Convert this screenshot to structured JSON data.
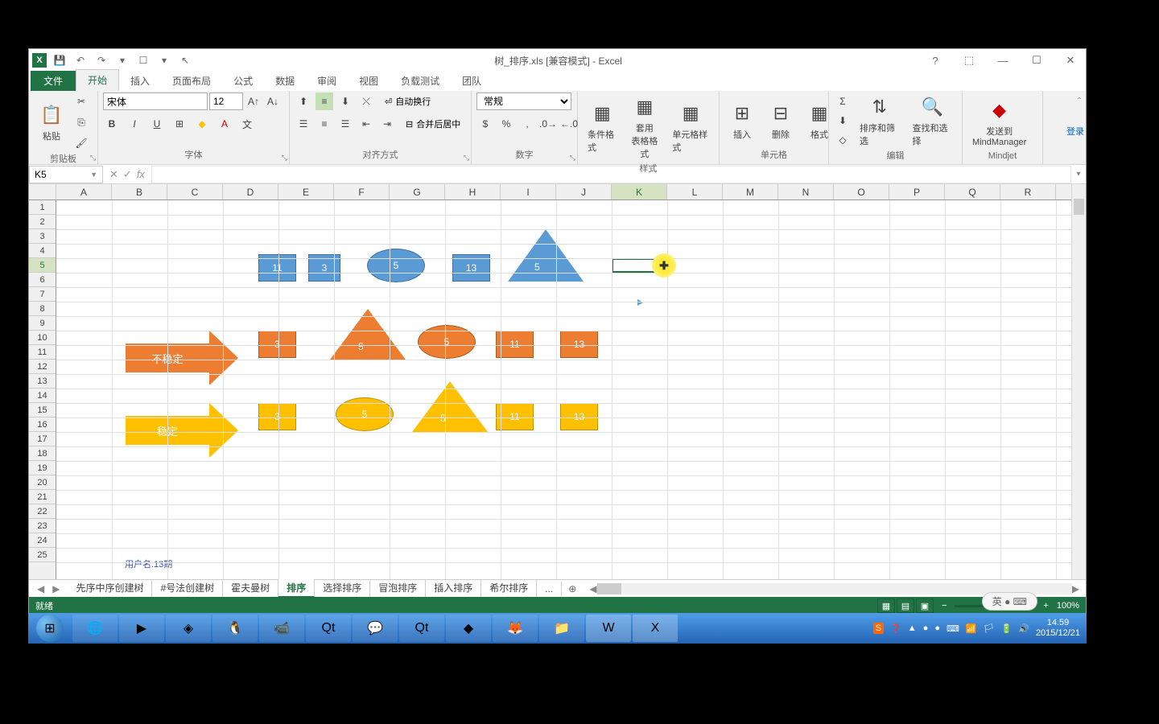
{
  "title": "树_排序.xls [兼容模式] - Excel",
  "login": "登录",
  "tabs": {
    "file": "文件",
    "items": [
      "开始",
      "插入",
      "页面布局",
      "公式",
      "数据",
      "审阅",
      "视图",
      "负载测试",
      "团队"
    ],
    "active": 0
  },
  "ribbon": {
    "clipboard": {
      "label": "剪贴板",
      "paste": "粘贴"
    },
    "font": {
      "label": "字体",
      "name": "宋体",
      "size": "12"
    },
    "alignment": {
      "label": "对齐方式",
      "wrap": "自动换行",
      "merge": "合并后居中"
    },
    "number": {
      "label": "数字",
      "format": "常规"
    },
    "styles": {
      "label": "样式",
      "cond": "条件格式",
      "table": "套用\n表格格式",
      "cell": "单元格样式"
    },
    "cells": {
      "label": "单元格",
      "insert": "插入",
      "delete": "删除",
      "format": "格式"
    },
    "editing": {
      "label": "编辑",
      "sort": "排序和筛选",
      "find": "查找和选择"
    },
    "mindjet": {
      "label": "Mindjet",
      "send": "发送到\nMindManager"
    }
  },
  "namebox": "K5",
  "columns": [
    "A",
    "B",
    "C",
    "D",
    "E",
    "F",
    "G",
    "H",
    "I",
    "J",
    "K",
    "L",
    "M",
    "N",
    "O",
    "P",
    "Q",
    "R"
  ],
  "selected_col": "K",
  "row_count": 25,
  "selected_row": 5,
  "shapes": {
    "row1": [
      {
        "type": "rect",
        "color": "blue",
        "label": "11"
      },
      {
        "type": "rect",
        "color": "blue",
        "label": "3"
      },
      {
        "type": "ellipse",
        "color": "blue",
        "label": "5"
      },
      {
        "type": "rect",
        "color": "blue",
        "label": "13"
      },
      {
        "type": "triangle",
        "color": "blue",
        "label": "5"
      }
    ],
    "arrow1_label": "不稳定",
    "row2": [
      {
        "type": "rect",
        "color": "orange",
        "label": "3"
      },
      {
        "type": "triangle",
        "color": "orange",
        "label": "5"
      },
      {
        "type": "ellipse",
        "color": "orange",
        "label": "5"
      },
      {
        "type": "rect",
        "color": "orange",
        "label": "11"
      },
      {
        "type": "rect",
        "color": "orange",
        "label": "13"
      }
    ],
    "arrow2_label": "稳定",
    "row3": [
      {
        "type": "rect",
        "color": "yellow",
        "label": "3"
      },
      {
        "type": "ellipse",
        "color": "yellow",
        "label": "5"
      },
      {
        "type": "triangle",
        "color": "yellow",
        "label": "5"
      },
      {
        "type": "rect",
        "color": "yellow",
        "label": "11"
      },
      {
        "type": "rect",
        "color": "yellow",
        "label": "13"
      }
    ]
  },
  "username": "用户名:13期",
  "sheets": [
    "先序中序创建树",
    "#号法创建树",
    "霍夫曼树",
    "排序",
    "选择排序",
    "冒泡排序",
    "插入排序",
    "希尔排序"
  ],
  "active_sheet": 3,
  "sheet_more": "...",
  "status": {
    "ready": "就绪",
    "zoom": "100%"
  },
  "ime": "英",
  "tray": {
    "time": "14:59",
    "date": "2015/12/21"
  }
}
